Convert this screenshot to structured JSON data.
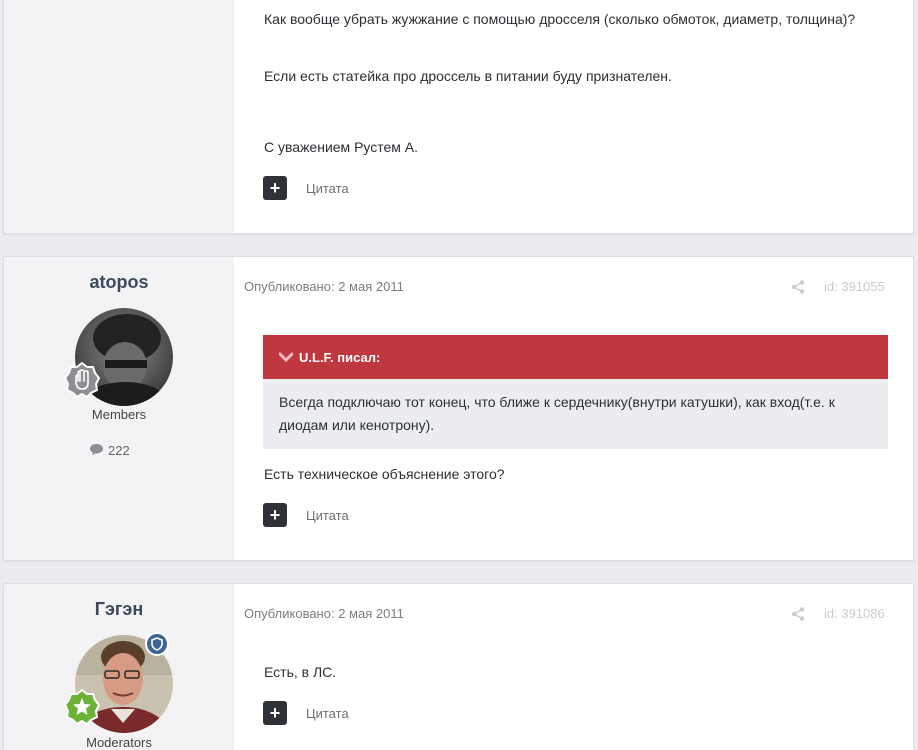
{
  "post1": {
    "lines": [
      "Как вообще убрать жужжание с помощью дросселя (сколько обмоток, диаметр, толщина)?",
      "Если есть статейка про дроссель в питании буду признателен.",
      "С уважением Рустем А."
    ],
    "quote_label": "Цитата"
  },
  "post2": {
    "author": "atopos",
    "group": "Members",
    "post_count": "222",
    "date": "Опубликовано: 2 мая 2011",
    "post_id": "id: 391055",
    "quote": {
      "author_label": "U.L.F. писал:",
      "text": "Всегда подключаю тот конец, что ближе к сердечнику(внутри катушки), как вход(т.е. к диодам или кенотрону)."
    },
    "text": "Есть техническое объяснение этого?",
    "quote_label": "Цитата"
  },
  "post3": {
    "author": "Гэгэн",
    "group": "Moderators",
    "date": "Опубликовано: 2 мая 2011",
    "post_id": "id: 391086",
    "text": "Есть, в ЛС.",
    "quote_label": "Цитата"
  },
  "icons": {
    "plus": "+",
    "chevron": "chevron-down-icon",
    "share": "share-icon",
    "comment": "comment-icon",
    "rank": "rank-badge-icon",
    "moderator": "moderator-shield-icon"
  },
  "colors": {
    "quote_header": "#c0383f",
    "page_bg": "#ebecf0",
    "author_bg": "#f3f3f5"
  }
}
